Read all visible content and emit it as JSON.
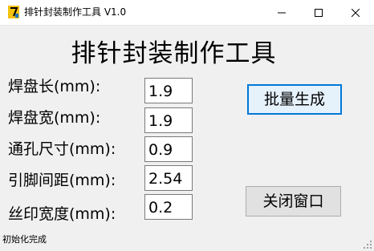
{
  "window": {
    "title": "排针封装制作工具 V1.0",
    "app_icon": "yellow-7-logo-icon",
    "controls": [
      "minimize-icon",
      "maximize-icon",
      "close-icon"
    ]
  },
  "heading": "排针封装制作工具",
  "fields": [
    {
      "label": "焊盘长(mm):",
      "value": "1.9"
    },
    {
      "label": "焊盘宽(mm):",
      "value": "1.9"
    },
    {
      "label": "通孔尺寸(mm):",
      "value": "0.9"
    },
    {
      "label": "引脚间距(mm):",
      "value": "2.54"
    },
    {
      "label": "丝印宽度(mm):",
      "value": "0.2"
    }
  ],
  "buttons": {
    "generate": "批量生成",
    "close": "关闭窗口"
  },
  "status": "初始化完成",
  "colors": {
    "accent_border": "#0078d7",
    "accent_fill": "#e5f1fb",
    "window_bg": "#f0f0f0",
    "icon_yellow": "#f4c20d"
  }
}
